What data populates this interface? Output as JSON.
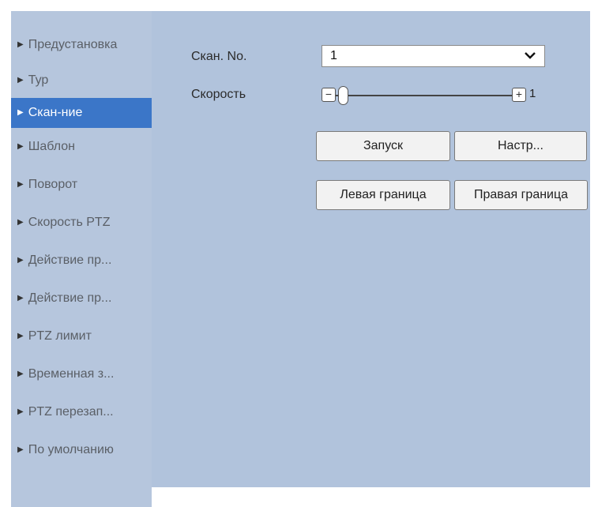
{
  "sidebar": {
    "items": [
      {
        "label": "Предустановка"
      },
      {
        "label": "Тур"
      },
      {
        "label": "Скан-ние"
      },
      {
        "label": "Шаблон"
      },
      {
        "label": "Поворот"
      },
      {
        "label": "Скорость PTZ"
      },
      {
        "label": "Действие пр..."
      },
      {
        "label": "Действие пр..."
      },
      {
        "label": "PTZ лимит"
      },
      {
        "label": "Временная з..."
      },
      {
        "label": "PTZ перезап..."
      },
      {
        "label": "По умолчанию"
      }
    ]
  },
  "form": {
    "scan_no_label": "Скан. No.",
    "scan_no_value": "1",
    "speed_label": "Скорость",
    "speed_value": "1",
    "minus": "−",
    "plus": "+"
  },
  "buttons": {
    "start": "Запуск",
    "setup": "Настр...",
    "left_limit": "Левая граница",
    "right_limit": "Правая граница"
  },
  "colors": {
    "panel_bg": "#b1c3dc",
    "active_item": "#3b76c8"
  }
}
